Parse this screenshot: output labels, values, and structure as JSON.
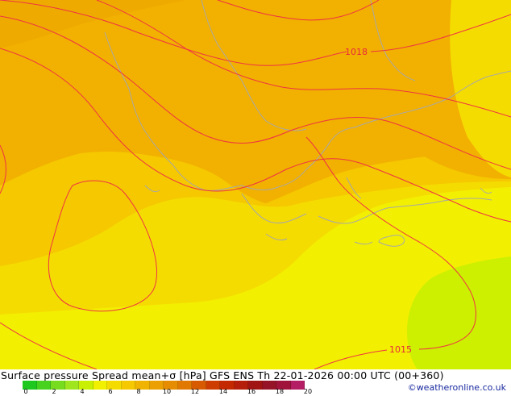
{
  "map": {
    "isobar_labels": [
      "1018",
      "1015"
    ],
    "colors": {
      "field_dark": "#f2b000",
      "field_mid": "#f5c800",
      "field_light": "#f5dc00",
      "field_yellow": "#f2f000",
      "field_green": "#cdf000",
      "isobar": "#ee3344",
      "coast": "#a8a8a8"
    }
  },
  "footer": {
    "caption": "Surface pressure Spread mean+σ [hPa] GFS ENS  Th 22-01-2026 00:00 UTC (00+360)",
    "credit": "©weatheronline.co.uk",
    "scale_ticks": [
      "0",
      "2",
      "4",
      "6",
      "8",
      "10",
      "12",
      "14",
      "16",
      "18",
      "20"
    ],
    "scale_colors": [
      "#1ec81e",
      "#46d21e",
      "#78dc1e",
      "#a0e61e",
      "#c8f000",
      "#f0f000",
      "#f5dc00",
      "#f5c800",
      "#f0b400",
      "#eba000",
      "#e68c00",
      "#e17800",
      "#d75a00",
      "#cd3c00",
      "#c32800",
      "#b41e0a",
      "#a01414",
      "#961428",
      "#a0143c",
      "#b41e64"
    ]
  }
}
